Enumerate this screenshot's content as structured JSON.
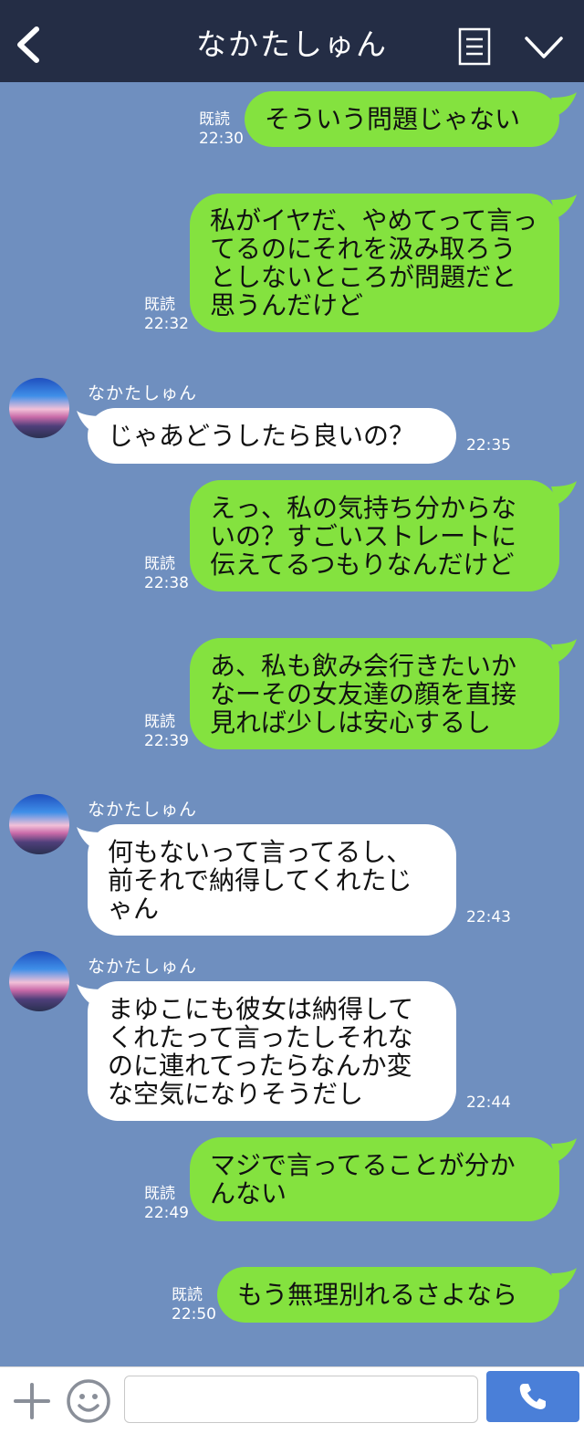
{
  "header": {
    "title": "なかたしゅん"
  },
  "messages": [
    {
      "type": "sent",
      "read": "既読",
      "time": "22:30",
      "text": "そういう問題じゃない"
    },
    {
      "type": "sent",
      "read": "既読",
      "time": "22:32",
      "text": "私がイヤだ、やめてって言ってるのにそれを汲み取ろうとしないところが問題だと思うんだけど"
    },
    {
      "type": "received",
      "sender": "なかたしゅん",
      "time": "22:35",
      "text": "じゃあどうしたら良いの？"
    },
    {
      "type": "sent",
      "read": "既読",
      "time": "22:38",
      "text": "えっ、私の気持ち分からないの？すごいストレートに伝えてるつもりなんだけど"
    },
    {
      "type": "sent",
      "read": "既読",
      "time": "22:39",
      "text": "あ、私も飲み会行きたいかなーその女友達の顔を直接見れば少しは安心するし"
    },
    {
      "type": "received",
      "sender": "なかたしゅん",
      "time": "22:43",
      "text": "何もないって言ってるし、前それで納得してくれたじゃん"
    },
    {
      "type": "received",
      "sender": "なかたしゅん",
      "time": "22:44",
      "text": "まゆこにも彼女は納得してくれたって言ったしそれなのに連れてったらなんか変な空気になりそうだし"
    },
    {
      "type": "sent",
      "read": "既読",
      "time": "22:49",
      "text": "マジで言ってることが分かんない"
    },
    {
      "type": "sent",
      "read": "既読",
      "time": "22:50",
      "text": "もう無理別れるさよなら"
    }
  ],
  "colors": {
    "background": "#6f8fbf",
    "header": "#242d45",
    "sent_bubble": "#84e23f",
    "received_bubble": "#ffffff",
    "call_button": "#4a7fd8"
  },
  "icons": {
    "back": "back-arrow-icon",
    "menu": "menu-list-icon",
    "collapse": "chevron-down-icon",
    "plus": "plus-icon",
    "emoji": "emoji-icon",
    "call": "phone-icon"
  }
}
